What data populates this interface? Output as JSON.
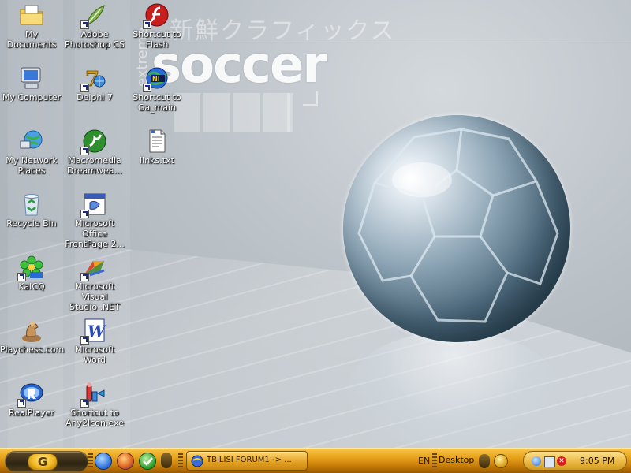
{
  "desktop": {
    "wallpaper": {
      "title": "soccer",
      "subtitle_vertical": "extreme",
      "kana_text": "新鮮クラフィックス"
    },
    "icons": [
      {
        "label": "My Documents",
        "icon": "folder-documents-icon",
        "shortcut": false
      },
      {
        "label": "My Computer",
        "icon": "computer-icon",
        "shortcut": false
      },
      {
        "label": "My Network\nPlaces",
        "icon": "network-icon",
        "shortcut": false
      },
      {
        "label": "Recycle Bin",
        "icon": "recycle-bin-icon",
        "shortcut": false
      },
      {
        "label": "KaICQ",
        "icon": "icq-flower-icon",
        "shortcut": true
      },
      {
        "label": "Playchess.com",
        "icon": "chess-knight-icon",
        "shortcut": false
      },
      {
        "label": "RealPlayer",
        "icon": "realplayer-icon",
        "shortcut": true
      },
      {
        "label": "Adobe\nPhotoshop CS",
        "icon": "photoshop-feather-icon",
        "shortcut": true
      },
      {
        "label": "Delphi 7",
        "icon": "delphi-icon",
        "shortcut": true
      },
      {
        "label": "Macromedia\nDreamwea...",
        "icon": "dreamweaver-icon",
        "shortcut": true
      },
      {
        "label": "Microsoft Office\nFrontPage 2...",
        "icon": "frontpage-icon",
        "shortcut": true
      },
      {
        "label": "Microsoft Visual\nStudio .NET",
        "icon": "visual-studio-icon",
        "shortcut": true
      },
      {
        "label": "Microsoft Word",
        "icon": "word-icon",
        "shortcut": true
      },
      {
        "label": "Shortcut to\nAny2Icon.exe",
        "icon": "any2icon-icon",
        "shortcut": true
      },
      {
        "label": "Shortcut to\nFlash",
        "icon": "flash-icon",
        "shortcut": true
      },
      {
        "label": "Shortcut to\nGa_main",
        "icon": "ni-globe-icon",
        "shortcut": true
      },
      {
        "label": "links.txt",
        "icon": "text-file-icon",
        "shortcut": false
      }
    ]
  },
  "taskbar": {
    "start_glyph": "G",
    "active_task": "TBILISI FORUM1 -> ...",
    "language": "EN",
    "desktop_toolbar": "Desktop",
    "clock": "9:05 PM",
    "colors": {
      "bar": "#e9a41c",
      "start": "#2e2412"
    }
  }
}
